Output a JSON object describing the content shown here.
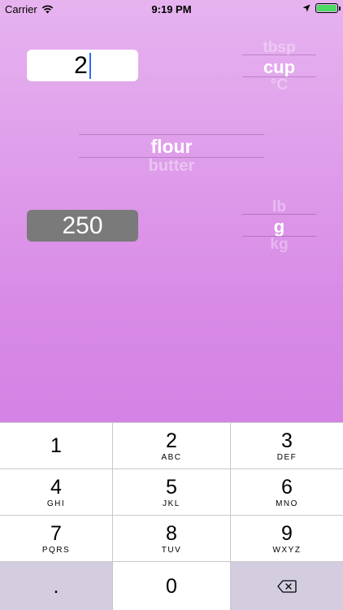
{
  "status_bar": {
    "carrier": "Carrier",
    "time": "9:19 PM"
  },
  "input": {
    "value": "2"
  },
  "output": {
    "value": "250"
  },
  "from_unit_picker": {
    "options": [
      "tbsp",
      "cup",
      "°C"
    ],
    "selected": "cup"
  },
  "ingredient_picker": {
    "options": [
      "flour",
      "butter"
    ],
    "selected": "flour"
  },
  "to_unit_picker": {
    "options": [
      "lb",
      "g",
      "kg"
    ],
    "selected": "g"
  },
  "keypad": {
    "keys": [
      {
        "num": "1",
        "letters": ""
      },
      {
        "num": "2",
        "letters": "ABC"
      },
      {
        "num": "3",
        "letters": "DEF"
      },
      {
        "num": "4",
        "letters": "GHI"
      },
      {
        "num": "5",
        "letters": "JKL"
      },
      {
        "num": "6",
        "letters": "MNO"
      },
      {
        "num": "7",
        "letters": "PQRS"
      },
      {
        "num": "8",
        "letters": "TUV"
      },
      {
        "num": "9",
        "letters": "WXYZ"
      },
      {
        "num": ".",
        "letters": ""
      },
      {
        "num": "0",
        "letters": ""
      }
    ],
    "delete_icon": "backspace-icon"
  },
  "colors": {
    "bg_top": "#e6b3ef",
    "bg_bottom": "#cd78e1",
    "caret": "#2f6cf5",
    "battery": "#4cd964"
  }
}
